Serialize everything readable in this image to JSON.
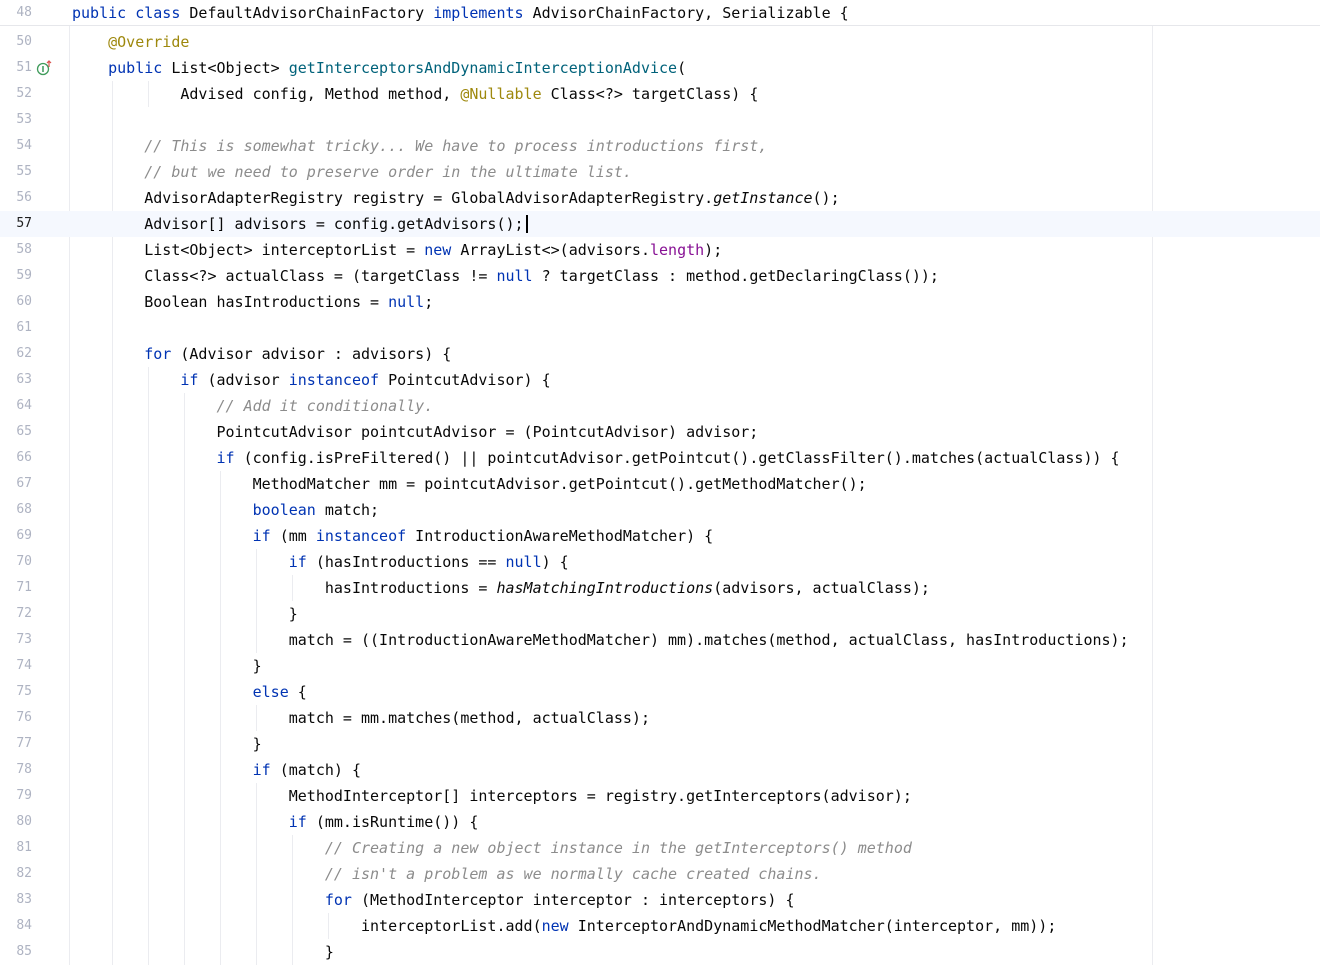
{
  "editor": {
    "sticky_header": {
      "line_number": "48",
      "text": "public class DefaultAdvisorChainFactory implements AdvisorChainFactory, Serializable {"
    },
    "current_line": "57",
    "gutter_icon": "implementation-marker-icon",
    "colors": {
      "keyword": "#0033b3",
      "comment": "#8c8c8c",
      "annotation": "#9e880d",
      "field": "#871094",
      "method_decl": "#00627a",
      "text": "#080808",
      "current_line_bg": "#f5f8fe"
    },
    "lines": [
      {
        "num": "50",
        "text": "    @Override"
      },
      {
        "num": "51",
        "text": "    public List<Object> getInterceptorsAndDynamicInterceptionAdvice("
      },
      {
        "num": "52",
        "text": "            Advised config, Method method, @Nullable Class<?> targetClass) {"
      },
      {
        "num": "53",
        "text": ""
      },
      {
        "num": "54",
        "text": "        // This is somewhat tricky... We have to process introductions first,"
      },
      {
        "num": "55",
        "text": "        // but we need to preserve order in the ultimate list."
      },
      {
        "num": "56",
        "text": "        AdvisorAdapterRegistry registry = GlobalAdvisorAdapterRegistry.getInstance();"
      },
      {
        "num": "57",
        "text": "        Advisor[] advisors = config.getAdvisors();"
      },
      {
        "num": "58",
        "text": "        List<Object> interceptorList = new ArrayList<>(advisors.length);"
      },
      {
        "num": "59",
        "text": "        Class<?> actualClass = (targetClass != null ? targetClass : method.getDeclaringClass());"
      },
      {
        "num": "60",
        "text": "        Boolean hasIntroductions = null;"
      },
      {
        "num": "61",
        "text": ""
      },
      {
        "num": "62",
        "text": "        for (Advisor advisor : advisors) {"
      },
      {
        "num": "63",
        "text": "            if (advisor instanceof PointcutAdvisor) {"
      },
      {
        "num": "64",
        "text": "                // Add it conditionally."
      },
      {
        "num": "65",
        "text": "                PointcutAdvisor pointcutAdvisor = (PointcutAdvisor) advisor;"
      },
      {
        "num": "66",
        "text": "                if (config.isPreFiltered() || pointcutAdvisor.getPointcut().getClassFilter().matches(actualClass)) {"
      },
      {
        "num": "67",
        "text": "                    MethodMatcher mm = pointcutAdvisor.getPointcut().getMethodMatcher();"
      },
      {
        "num": "68",
        "text": "                    boolean match;"
      },
      {
        "num": "69",
        "text": "                    if (mm instanceof IntroductionAwareMethodMatcher) {"
      },
      {
        "num": "70",
        "text": "                        if (hasIntroductions == null) {"
      },
      {
        "num": "71",
        "text": "                            hasIntroductions = hasMatchingIntroductions(advisors, actualClass);"
      },
      {
        "num": "72",
        "text": "                        }"
      },
      {
        "num": "73",
        "text": "                        match = ((IntroductionAwareMethodMatcher) mm).matches(method, actualClass, hasIntroductions);"
      },
      {
        "num": "74",
        "text": "                    }"
      },
      {
        "num": "75",
        "text": "                    else {"
      },
      {
        "num": "76",
        "text": "                        match = mm.matches(method, actualClass);"
      },
      {
        "num": "77",
        "text": "                    }"
      },
      {
        "num": "78",
        "text": "                    if (match) {"
      },
      {
        "num": "79",
        "text": "                        MethodInterceptor[] interceptors = registry.getInterceptors(advisor);"
      },
      {
        "num": "80",
        "text": "                        if (mm.isRuntime()) {"
      },
      {
        "num": "81",
        "text": "                            // Creating a new object instance in the getInterceptors() method"
      },
      {
        "num": "82",
        "text": "                            // isn't a problem as we normally cache created chains."
      },
      {
        "num": "83",
        "text": "                            for (MethodInterceptor interceptor : interceptors) {"
      },
      {
        "num": "84",
        "text": "                                interceptorList.add(new InterceptorAndDynamicMethodMatcher(interceptor, mm));"
      },
      {
        "num": "85",
        "text": "                            }"
      }
    ]
  }
}
